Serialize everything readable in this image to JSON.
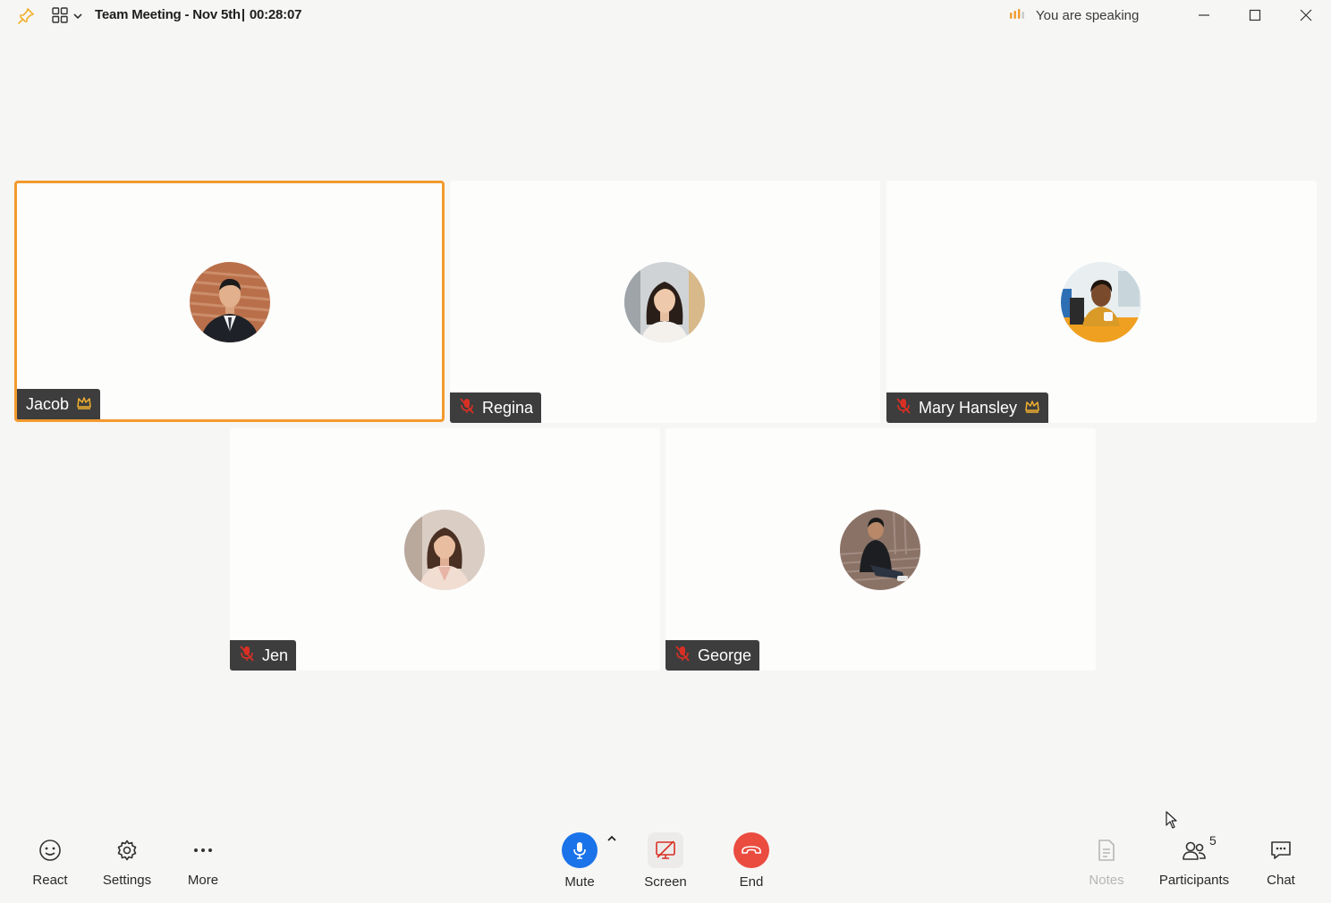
{
  "titlebar": {
    "meeting_name": "Team Meeting - Nov 5th",
    "separator": "|",
    "elapsed": "00:28:07",
    "speaking_status": "You are speaking",
    "icons": [
      "pin-icon",
      "grid-layout-icon",
      "chevron-down-icon",
      "audio-level-icon",
      "minimize-icon",
      "maximize-icon",
      "close-icon"
    ]
  },
  "participants": [
    {
      "name": "Jacob",
      "active_speaker": true,
      "muted": false,
      "host": true
    },
    {
      "name": "Regina",
      "active_speaker": false,
      "muted": true,
      "host": false
    },
    {
      "name": "Mary Hansley",
      "active_speaker": false,
      "muted": true,
      "host": true
    },
    {
      "name": "Jen",
      "active_speaker": false,
      "muted": true,
      "host": false
    },
    {
      "name": "George",
      "active_speaker": false,
      "muted": true,
      "host": false
    }
  ],
  "toolbar": {
    "react": "React",
    "settings": "Settings",
    "more": "More",
    "mute": "Mute",
    "screen": "Screen",
    "end": "End",
    "notes": "Notes",
    "participants": "Participants",
    "participants_count": "5",
    "chat": "Chat"
  },
  "colors": {
    "accent": "#f29a2e",
    "mic_blue": "#1a73e8",
    "end_red": "#ea4c3f",
    "muted_red": "#d93025",
    "nametag_bg": "#3d3d3d"
  }
}
